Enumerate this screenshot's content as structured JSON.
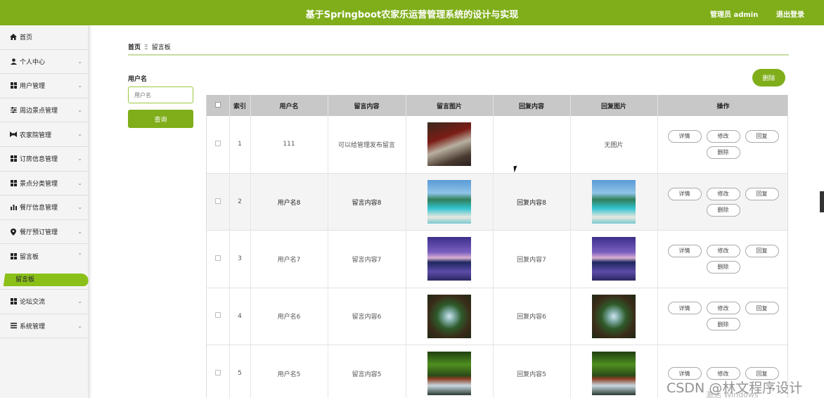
{
  "header": {
    "title": "基于Springboot农家乐运营管理系统的设计与实现",
    "admin_label": "管理员 admin",
    "logout_label": "退出登录"
  },
  "sidebar": {
    "items": [
      {
        "label": "首页",
        "icon": "home-icon"
      },
      {
        "label": "个人中心",
        "icon": "user-icon"
      },
      {
        "label": "用户管理",
        "icon": "grid-icon"
      },
      {
        "label": "周边景点管理",
        "icon": "sliders-icon"
      },
      {
        "label": "农家院管理",
        "icon": "bowtie-icon"
      },
      {
        "label": "订房信息管理",
        "icon": "grid-icon"
      },
      {
        "label": "景点分类管理",
        "icon": "grid-icon"
      },
      {
        "label": "餐厅信息管理",
        "icon": "bar-chart-icon"
      },
      {
        "label": "餐厅预订管理",
        "icon": "location-pin-icon"
      },
      {
        "label": "留言板",
        "icon": "grid-icon"
      },
      {
        "label": "论坛交流",
        "icon": "grid-icon"
      },
      {
        "label": "系统管理",
        "icon": "list-icon"
      }
    ],
    "active_sub": "留言板"
  },
  "breadcrumb": {
    "home": "首页",
    "separator": "Ξ",
    "current": "留言板"
  },
  "search": {
    "label": "用户名",
    "placeholder": "用户名",
    "button": "查询"
  },
  "delete_button": "删除",
  "table": {
    "headers": [
      "索引",
      "用户名",
      "留言内容",
      "留言图片",
      "回复内容",
      "回复图片",
      "操作"
    ],
    "actions": {
      "detail": "详情",
      "edit": "修改",
      "reply": "回复",
      "delete": "删除"
    },
    "no_image_text": "无图片",
    "rows": [
      {
        "index": "1",
        "username": "111",
        "content": "可以给管理发布留言",
        "image": "car-photo",
        "reply": "",
        "reply_image": ""
      },
      {
        "index": "2",
        "username": "用户名8",
        "content": "留言内容8",
        "image": "beach-photo",
        "reply": "回复内容8",
        "reply_image": "beach-photo"
      },
      {
        "index": "3",
        "username": "用户名7",
        "content": "留言内容7",
        "image": "lake-photo",
        "reply": "回复内容7",
        "reply_image": "lake-photo"
      },
      {
        "index": "4",
        "username": "用户名6",
        "content": "留言内容6",
        "image": "forest-photo",
        "reply": "回复内容6",
        "reply_image": "forest-photo"
      },
      {
        "index": "5",
        "username": "用户名5",
        "content": "留言内容5",
        "image": "waterfall-photo",
        "reply": "回复内容5",
        "reply_image": "waterfall-photo"
      }
    ]
  },
  "watermark": {
    "csdn": "CSDN @林文程序设计",
    "windows": "激活 Windows"
  },
  "colors": {
    "brand": "#7fae1a",
    "table_header": "#c8c8c8"
  }
}
